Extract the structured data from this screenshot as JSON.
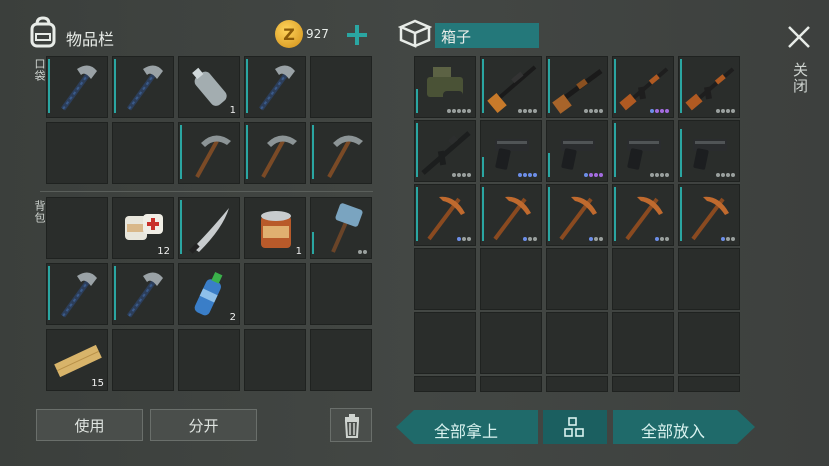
{
  "inventory": {
    "title": "物品栏",
    "currency": "927",
    "pocket_label": "口袋",
    "backpack_label": "背包"
  },
  "chest": {
    "title": "箱子"
  },
  "close": {
    "label": "关闭"
  },
  "actions": {
    "use": "使用",
    "split": "分开",
    "take_all": "全部拿上",
    "put_all": "全部放入"
  },
  "pocket_slots": [
    {
      "item": "hatchet",
      "count": ""
    },
    {
      "item": "hatchet",
      "count": ""
    },
    {
      "item": "plastic-bottle",
      "count": "1"
    },
    {
      "item": "hatchet",
      "count": ""
    },
    {
      "item": "empty",
      "count": ""
    },
    {
      "item": "empty",
      "count": ""
    },
    {
      "item": "empty",
      "count": ""
    },
    {
      "item": "pickaxe",
      "count": ""
    },
    {
      "item": "pickaxe",
      "count": ""
    },
    {
      "item": "pickaxe",
      "count": ""
    }
  ],
  "backpack_slots": [
    {
      "item": "empty",
      "count": ""
    },
    {
      "item": "bandage",
      "count": "12"
    },
    {
      "item": "machete",
      "count": ""
    },
    {
      "item": "canned-food",
      "count": "1"
    },
    {
      "item": "sledgehammer",
      "count": ""
    },
    {
      "item": "hatchet",
      "count": ""
    },
    {
      "item": "hatchet",
      "count": ""
    },
    {
      "item": "water-bottle",
      "count": "2"
    },
    {
      "item": "empty",
      "count": ""
    },
    {
      "item": "empty",
      "count": ""
    },
    {
      "item": "planks",
      "count": "15"
    },
    {
      "item": "empty",
      "count": ""
    },
    {
      "item": "empty",
      "count": ""
    },
    {
      "item": "empty",
      "count": ""
    },
    {
      "item": "empty",
      "count": ""
    }
  ],
  "chest_slots": [
    {
      "item": "gun-bundle"
    },
    {
      "item": "sniper-rifle"
    },
    {
      "item": "shotgun"
    },
    {
      "item": "ak-rifle"
    },
    {
      "item": "ak-rifle"
    },
    {
      "item": "m16-rifle"
    },
    {
      "item": "pistol"
    },
    {
      "item": "pistol"
    },
    {
      "item": "pistol"
    },
    {
      "item": "pistol"
    },
    {
      "item": "copper-pickaxe"
    },
    {
      "item": "copper-pickaxe"
    },
    {
      "item": "copper-pickaxe"
    },
    {
      "item": "copper-pickaxe"
    },
    {
      "item": "copper-pickaxe"
    }
  ],
  "colors": {
    "accent": "#2aa6a2",
    "button_teal": "#1f6a6a",
    "coin": "#e0a92a"
  }
}
